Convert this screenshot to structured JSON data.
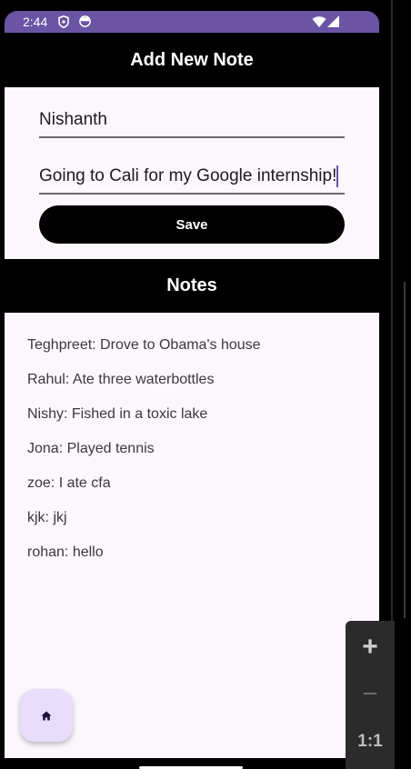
{
  "status_bar": {
    "time": "2:44",
    "background": "#6a54a3",
    "icons": [
      "shield-icon",
      "face-icon",
      "wifi-icon",
      "signal-icon"
    ]
  },
  "header": {
    "title": "Add New Note"
  },
  "form": {
    "name_value": "Nishanth",
    "note_value": "Going to Cali for my Google internship!",
    "save_label": "Save"
  },
  "notes_header": {
    "title": "Notes"
  },
  "notes": [
    "Teghpreet: Drove to Obama's house",
    "Rahul: Ate three waterbottles",
    "Nishy: Fished in a toxic lake",
    "Jona: Played tennis",
    "zoe: I ate cfa",
    "kjk: jkj",
    "rohan: hello"
  ],
  "fab": {
    "icon": "home-icon",
    "background": "#e8ddfa"
  },
  "zoom_controls": {
    "zoom_in": "+",
    "zoom_out": "−",
    "reset": "1:1"
  },
  "colors": {
    "surface": "#fcf7fc",
    "accent": "#6a54a3",
    "bar": "#000000"
  }
}
